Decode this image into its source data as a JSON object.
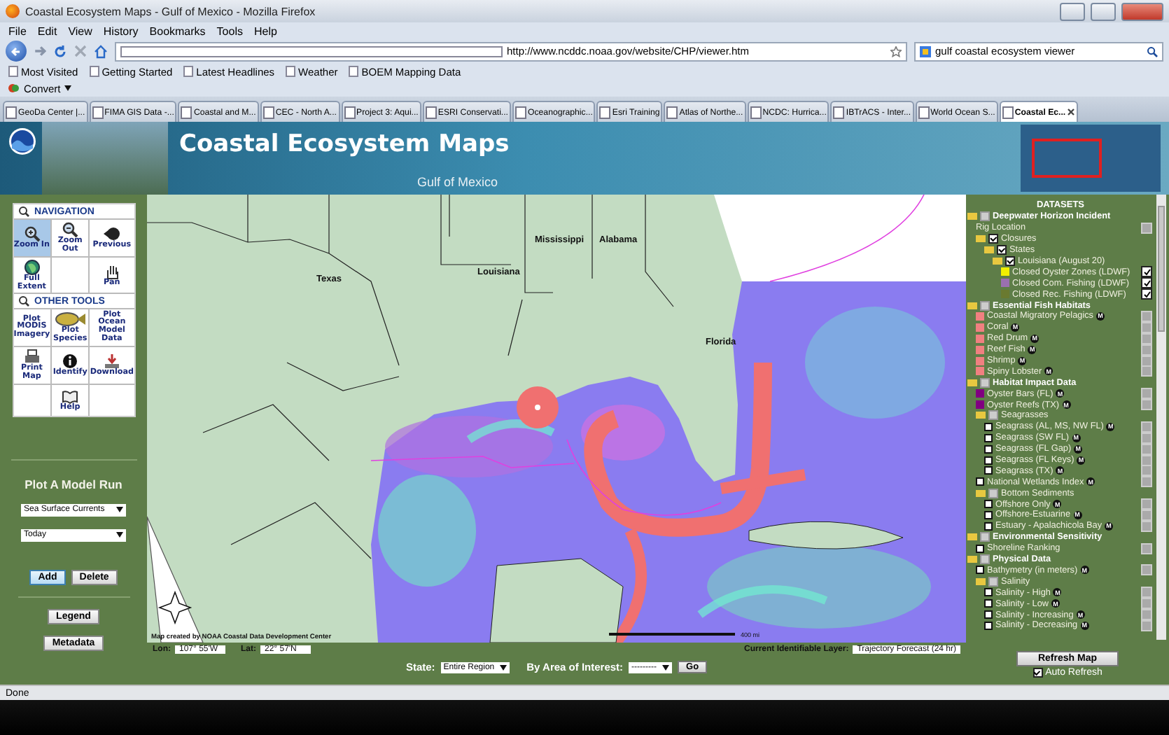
{
  "window": {
    "title": "Coastal Ecosystem Maps - Gulf of Mexico - Mozilla Firefox"
  },
  "menu": [
    "File",
    "Edit",
    "View",
    "History",
    "Bookmarks",
    "Tools",
    "Help"
  ],
  "address": {
    "url": "http://www.ncddc.noaa.gov/website/CHP/viewer.htm"
  },
  "search": {
    "value": "gulf coastal ecosystem viewer"
  },
  "bookmarks": [
    "Most Visited",
    "Getting Started",
    "Latest Headlines",
    "Weather",
    "BOEM Mapping Data"
  ],
  "addon_bar": {
    "label": "Convert"
  },
  "tabs": [
    {
      "label": "GeoDa Center |...",
      "selected": false
    },
    {
      "label": "FIMA GIS Data -...",
      "selected": false
    },
    {
      "label": "Coastal and M...",
      "selected": false
    },
    {
      "label": "CEC - North A...",
      "selected": false
    },
    {
      "label": "Project 3: Aqui...",
      "selected": false
    },
    {
      "label": "ESRI Conservati...",
      "selected": false
    },
    {
      "label": "Oceanographic...",
      "selected": false
    },
    {
      "label": "Esri Training",
      "selected": false
    },
    {
      "label": "Atlas of Northe...",
      "selected": false
    },
    {
      "label": "NCDC: Hurrica...",
      "selected": false
    },
    {
      "label": "IBTrACS - Inter...",
      "selected": false
    },
    {
      "label": "World Ocean S...",
      "selected": false
    },
    {
      "label": "Coastal Ec...",
      "selected": true
    }
  ],
  "banner": {
    "title": "Coastal Ecosystem Maps",
    "subtitle": "Gulf of Mexico"
  },
  "tools": {
    "sections": [
      {
        "title": "NAVIGATION",
        "items": [
          {
            "kind": "tool",
            "label": "Zoom In",
            "selected": true
          },
          {
            "kind": "tool",
            "label": "Zoom Out",
            "selected": false
          },
          {
            "kind": "tool",
            "label": "Previous",
            "selected": false
          },
          {
            "kind": "tool",
            "label": "Full Extent",
            "selected": false
          },
          {
            "kind": "empty"
          },
          {
            "kind": "tool",
            "label": "Pan",
            "selected": false
          }
        ]
      },
      {
        "title": "OTHER TOOLS",
        "items": [
          {
            "kind": "tool",
            "label": "Plot MODIS Imagery",
            "selected": false
          },
          {
            "kind": "tool",
            "label": "Plot Species",
            "selected": false
          },
          {
            "kind": "tool",
            "label": "Plot Ocean Model Data",
            "selected": false
          },
          {
            "kind": "tool",
            "label": "Print Map",
            "selected": false
          },
          {
            "kind": "tool",
            "label": "Identify",
            "selected": false
          },
          {
            "kind": "tool",
            "label": "Download",
            "selected": false
          },
          {
            "kind": "empty"
          },
          {
            "kind": "tool",
            "label": "Help",
            "selected": false
          },
          {
            "kind": "empty"
          }
        ]
      }
    ]
  },
  "model_run": {
    "title": "Plot A Model Run",
    "selects": [
      "Sea Surface Currents",
      "Today"
    ],
    "buttons": [
      {
        "label": "Add",
        "selected": true
      },
      {
        "label": "Delete",
        "selected": false
      }
    ],
    "more_buttons": [
      "Legend",
      "Metadata"
    ]
  },
  "map": {
    "labels": [
      "Texas",
      "Louisiana",
      "Mississippi",
      "Alabama",
      "Florida"
    ],
    "credit": "Map created by NOAA Coastal Data Development Center",
    "scale": "400 mi"
  },
  "coordinates": {
    "lon_label": "Lon:",
    "lon": "107° 55'W",
    "lat_label": "Lat:",
    "lat": "22° 57'N",
    "layer_label": "Current Identifiable Layer:",
    "layer": "Trajectory Forecast (24 hr)"
  },
  "query": {
    "state_label": "State:",
    "state": "Entire Region",
    "area_label": "By Area of Interest:",
    "area": "---------",
    "go": "Go"
  },
  "datasets": {
    "title": "DATASETS",
    "items": [
      {
        "kind": "group",
        "label": "Deepwater Horizon Incident",
        "checked": false,
        "children": [
          {
            "kind": "plain",
            "label": "Rig Location",
            "visible": false
          },
          {
            "kind": "folder",
            "label": "Closures",
            "checked": true,
            "children": [
              {
                "kind": "folder",
                "label": "States",
                "checked": true,
                "children": [
                  {
                    "kind": "folder",
                    "label": "Louisiana (August 20)",
                    "checked": true,
                    "children": [
                      {
                        "kind": "swatch",
                        "label": "Closed Oyster Zones (LDWF)",
                        "color": "#f0f000",
                        "visible": true
                      },
                      {
                        "kind": "swatch",
                        "label": "Closed Com. Fishing (LDWF)",
                        "color": "#9a70b0",
                        "visible": true
                      },
                      {
                        "kind": "swatch",
                        "label": "Closed Rec. Fishing (LDWF)",
                        "color": "#6a7a30",
                        "visible": true
                      }
                    ]
                  }
                ]
              }
            ]
          }
        ]
      },
      {
        "kind": "group",
        "label": "Essential Fish Habitats",
        "checked": false,
        "children": [
          {
            "kind": "swatch",
            "label": "Coastal Migratory Pelagics",
            "color": "#f08080",
            "meta": "M",
            "visible": false
          },
          {
            "kind": "swatch",
            "label": "Coral",
            "color": "#f08080",
            "meta": "M",
            "visible": false
          },
          {
            "kind": "swatch",
            "label": "Red Drum",
            "color": "#f08080",
            "meta": "M",
            "visible": false
          },
          {
            "kind": "swatch",
            "label": "Reef Fish",
            "color": "#f08080",
            "meta": "M",
            "visible": false
          },
          {
            "kind": "swatch",
            "label": "Shrimp",
            "color": "#f08080",
            "meta": "M",
            "visible": false
          },
          {
            "kind": "swatch",
            "label": "Spiny Lobster",
            "color": "#f08080",
            "meta": "M",
            "visible": false
          }
        ]
      },
      {
        "kind": "group",
        "label": "Habitat Impact Data",
        "checked": false,
        "children": [
          {
            "kind": "swatch",
            "label": "Oyster Bars (FL)",
            "color": "#800080",
            "meta": "M",
            "visible": false
          },
          {
            "kind": "swatch",
            "label": "Oyster Reefs (TX)",
            "color": "#800080",
            "meta": "M",
            "visible": false
          },
          {
            "kind": "folder",
            "label": "Seagrasses",
            "checked": false,
            "children": [
              {
                "kind": "layer",
                "label": "Seagrass (AL, MS, NW FL)",
                "checked": false,
                "meta": "M",
                "visible": false
              },
              {
                "kind": "layer",
                "label": "Seagrass (SW FL)",
                "checked": false,
                "meta": "M",
                "visible": false
              },
              {
                "kind": "layer",
                "label": "Seagrass (FL Gap)",
                "checked": false,
                "meta": "M",
                "visible": false
              },
              {
                "kind": "layer",
                "label": "Seagrass (FL Keys)",
                "checked": false,
                "meta": "M",
                "visible": false
              },
              {
                "kind": "layer",
                "label": "Seagrass (TX)",
                "checked": false,
                "meta": "M",
                "visible": false
              }
            ]
          },
          {
            "kind": "layer",
            "label": "National Wetlands Index",
            "checked": false,
            "meta": "M",
            "visible": false
          },
          {
            "kind": "folder",
            "label": "Bottom Sediments",
            "checked": false,
            "children": [
              {
                "kind": "layer",
                "label": "Offshore Only",
                "checked": false,
                "meta": "M",
                "visible": false
              },
              {
                "kind": "layer",
                "label": "Offshore-Estuarine",
                "checked": false,
                "meta": "M",
                "visible": false
              },
              {
                "kind": "layer",
                "label": "Estuary - Apalachicola Bay",
                "checked": false,
                "meta": "M",
                "visible": false
              }
            ]
          }
        ]
      },
      {
        "kind": "group",
        "label": "Environmental Sensitivity",
        "checked": false,
        "children": [
          {
            "kind": "layer",
            "label": "Shoreline Ranking",
            "checked": false,
            "visible": false
          }
        ]
      },
      {
        "kind": "group",
        "label": "Physical Data",
        "checked": false,
        "children": [
          {
            "kind": "layer",
            "label": "Bathymetry (in meters)",
            "checked": false,
            "meta": "M",
            "visible": false
          },
          {
            "kind": "folder",
            "label": "Salinity",
            "checked": false,
            "children": [
              {
                "kind": "layer",
                "label": "Salinity - High",
                "checked": false,
                "meta": "M",
                "visible": false
              },
              {
                "kind": "layer",
                "label": "Salinity - Low",
                "checked": false,
                "meta": "M",
                "visible": false
              },
              {
                "kind": "layer",
                "label": "Salinity - Increasing",
                "checked": false,
                "meta": "M",
                "visible": false
              },
              {
                "kind": "layer",
                "label": "Salinity - Decreasing",
                "checked": false,
                "meta": "M",
                "visible": false
              }
            ]
          }
        ]
      }
    ],
    "refresh": "Refresh Map",
    "auto_refresh": {
      "label": "Auto Refresh",
      "checked": true
    }
  },
  "status_bar": {
    "text": "Done"
  }
}
